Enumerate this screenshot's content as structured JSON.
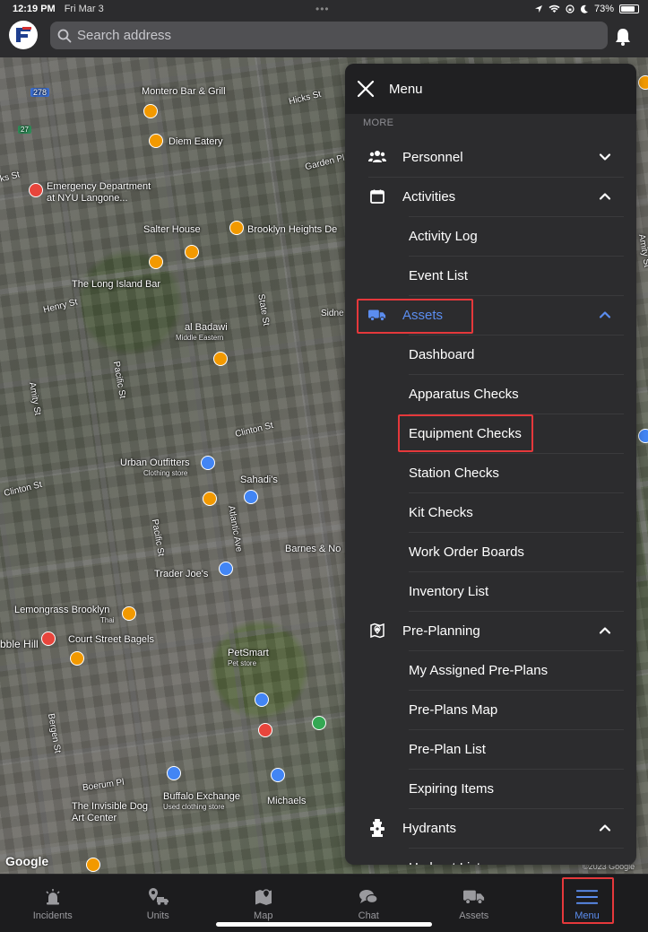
{
  "status_bar": {
    "time": "12:19 PM",
    "date": "Fri Mar 3",
    "battery": "73%",
    "battery_level": 0.73
  },
  "header": {
    "search_placeholder": "Search address"
  },
  "map": {
    "labels": [
      {
        "text": "Montero Bar & Grill",
        "sub": ""
      },
      {
        "text": "Hicks St",
        "sub": ""
      },
      {
        "text": "Diem Eatery",
        "sub": ""
      },
      {
        "text": "Garden Pl",
        "sub": ""
      },
      {
        "text": "Emergency Department at NYU Langone...",
        "sub": ""
      },
      {
        "text": "Salter House",
        "sub": ""
      },
      {
        "text": "Brooklyn Heights De",
        "sub": ""
      },
      {
        "text": "The Long Island Bar",
        "sub": ""
      },
      {
        "text": "Henry St",
        "sub": ""
      },
      {
        "text": "Sidne",
        "sub": ""
      },
      {
        "text": "al Badawi",
        "sub": "Middle Eastern"
      },
      {
        "text": "Pacific St",
        "sub": ""
      },
      {
        "text": "State St",
        "sub": ""
      },
      {
        "text": "Amity St",
        "sub": ""
      },
      {
        "text": "Clinton St",
        "sub": ""
      },
      {
        "text": "Urban Outfitters",
        "sub": "Clothing store"
      },
      {
        "text": "Sahadi's",
        "sub": ""
      },
      {
        "text": "Clinton St",
        "sub": ""
      },
      {
        "text": "Pacific St",
        "sub": ""
      },
      {
        "text": "Barnes & No",
        "sub": ""
      },
      {
        "text": "Trader Joe's",
        "sub": ""
      },
      {
        "text": "Lemongrass Brooklyn",
        "sub": "Thai"
      },
      {
        "text": "Court Street Bagels",
        "sub": ""
      },
      {
        "text": "bble Hill",
        "sub": ""
      },
      {
        "text": "PetSmart",
        "sub": "Pet store"
      },
      {
        "text": "Bergen St",
        "sub": ""
      },
      {
        "text": "Boerum Pl",
        "sub": ""
      },
      {
        "text": "Buffalo Exchange",
        "sub": "Used clothing store"
      },
      {
        "text": "Michaels",
        "sub": ""
      },
      {
        "text": "The Invisible Dog Art Center",
        "sub": ""
      },
      {
        "text": "ks St",
        "sub": ""
      },
      {
        "text": "Amity St",
        "sub": ""
      },
      {
        "text": "Atlantic Ave",
        "sub": ""
      },
      {
        "text": "278",
        "sub": ""
      },
      {
        "text": "27",
        "sub": ""
      }
    ],
    "google": "Google",
    "copyright": "©2023 Google"
  },
  "menu": {
    "title": "Menu",
    "section_label": "MORE",
    "items": [
      {
        "label": "Personnel",
        "type": "parent",
        "icon": "people-icon",
        "chevron": "down"
      },
      {
        "label": "Activities",
        "type": "parent",
        "icon": "calendar-icon",
        "chevron": "up"
      },
      {
        "label": "Activity Log",
        "type": "child"
      },
      {
        "label": "Event List",
        "type": "child"
      },
      {
        "label": "Assets",
        "type": "parent",
        "icon": "truck-icon",
        "chevron": "up",
        "active": true
      },
      {
        "label": "Dashboard",
        "type": "child"
      },
      {
        "label": "Apparatus Checks",
        "type": "child"
      },
      {
        "label": "Equipment Checks",
        "type": "child"
      },
      {
        "label": "Station Checks",
        "type": "child"
      },
      {
        "label": "Kit Checks",
        "type": "child"
      },
      {
        "label": "Work Order Boards",
        "type": "child"
      },
      {
        "label": "Inventory List",
        "type": "child"
      },
      {
        "label": "Pre-Planning",
        "type": "parent",
        "icon": "map-pin-icon",
        "chevron": "up"
      },
      {
        "label": "My Assigned Pre-Plans",
        "type": "child"
      },
      {
        "label": "Pre-Plans Map",
        "type": "child"
      },
      {
        "label": "Pre-Plan List",
        "type": "child"
      },
      {
        "label": "Expiring Items",
        "type": "child"
      },
      {
        "label": "Hydrants",
        "type": "parent",
        "icon": "hydrant-icon",
        "chevron": "up"
      },
      {
        "label": "Hydrant List",
        "type": "child"
      }
    ]
  },
  "tabbar": {
    "tabs": [
      {
        "label": "Incidents",
        "icon": "alarm-icon"
      },
      {
        "label": "Units",
        "icon": "units-icon"
      },
      {
        "label": "Map",
        "icon": "map-icon"
      },
      {
        "label": "Chat",
        "icon": "chat-icon"
      },
      {
        "label": "Assets",
        "icon": "truck-icon"
      },
      {
        "label": "Menu",
        "icon": "hamburger-icon",
        "active": true
      }
    ]
  },
  "colors": {
    "accent": "#5b8def",
    "highlight": "#e5383b",
    "panel": "#2c2c2e"
  }
}
